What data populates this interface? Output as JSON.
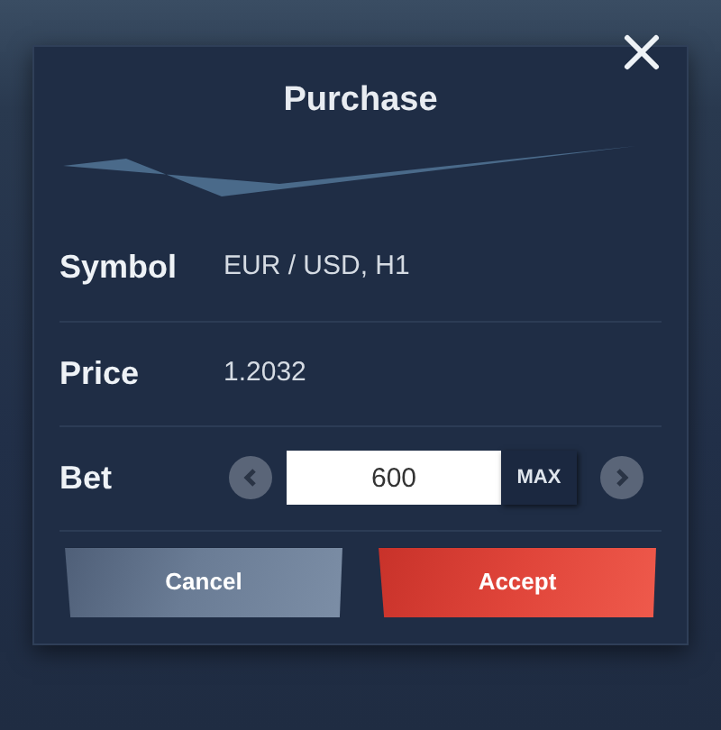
{
  "dialog": {
    "title": "Purchase",
    "rows": [
      {
        "label": "Symbol",
        "value": "EUR / USD, H1"
      },
      {
        "label": "Price",
        "value": "1.2032"
      }
    ],
    "bet": {
      "label": "Bet",
      "value": "600",
      "max": "MAX"
    },
    "buttons": [
      {
        "label": "Cancel",
        "kind": "secondary"
      },
      {
        "label": "Accept",
        "kind": "primary"
      }
    ]
  }
}
